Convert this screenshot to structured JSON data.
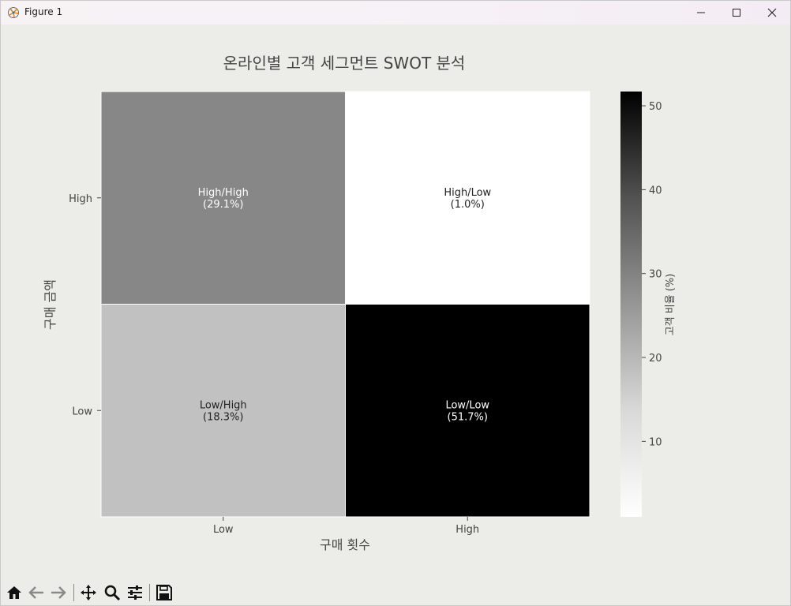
{
  "window": {
    "title": "Figure 1",
    "controls": {
      "minimize_icon": "minimize-icon",
      "maximize_icon": "maximize-icon",
      "close_icon": "close-icon"
    }
  },
  "toolbar": {
    "tools": [
      {
        "name": "home",
        "icon": "home-icon"
      },
      {
        "name": "back",
        "icon": "back-arrow-icon"
      },
      {
        "name": "forward",
        "icon": "forward-arrow-icon"
      },
      {
        "name": "pan",
        "icon": "pan-icon"
      },
      {
        "name": "zoom",
        "icon": "zoom-icon"
      },
      {
        "name": "configure",
        "icon": "sliders-icon"
      },
      {
        "name": "save",
        "icon": "save-icon"
      }
    ]
  },
  "chart_data": {
    "type": "heatmap",
    "title": "온라인별 고객 세그먼트 SWOT 분석",
    "xlabel": "구매 횟수",
    "ylabel": "구매 금액",
    "x_categories": [
      "Low",
      "High"
    ],
    "y_categories": [
      "High",
      "Low"
    ],
    "cells": [
      {
        "row": "High",
        "col": "Low",
        "label": "High/High",
        "percent_text": "(29.1%)",
        "value": 29.1
      },
      {
        "row": "High",
        "col": "High",
        "label": "High/Low",
        "percent_text": "(1.0%)",
        "value": 1.0
      },
      {
        "row": "Low",
        "col": "Low",
        "label": "Low/High",
        "percent_text": "(18.3%)",
        "value": 18.3
      },
      {
        "row": "Low",
        "col": "High",
        "label": "Low/Low",
        "percent_text": "(51.7%)",
        "value": 51.7
      }
    ],
    "colormap": "Greys",
    "colorbar": {
      "label": "고객 비율 (%)",
      "range": [
        1.0,
        51.7
      ],
      "ticks": [
        10,
        20,
        30,
        40,
        50
      ]
    }
  }
}
